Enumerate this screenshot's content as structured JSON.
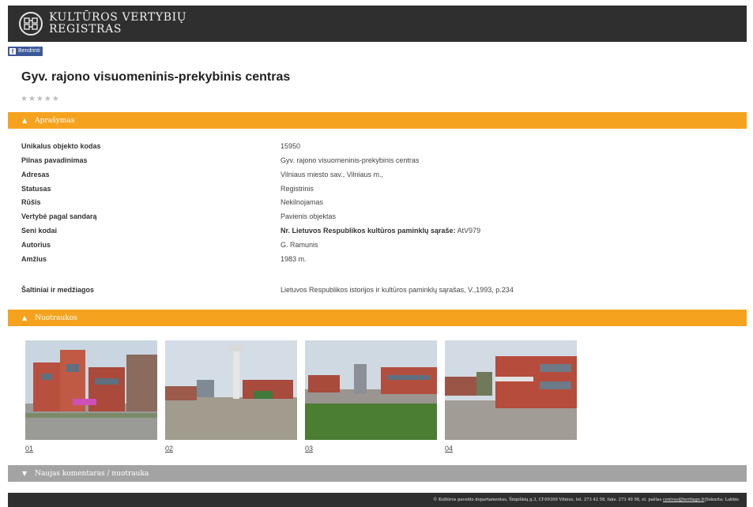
{
  "header": {
    "brand_line1": "KULTŪROS VERTYBIŲ",
    "brand_line2": "REGISTRAS"
  },
  "share": {
    "label": "Bendrinti"
  },
  "page": {
    "title": "Gyv. rajono visuomeninis-prekybinis centras",
    "rating_stars": "★★★★★",
    "rating_value": 0
  },
  "sections": {
    "description": "Aprašymas",
    "photos": "Nuotraukos",
    "new_comment": "Naujas komentaras / nuotrauka"
  },
  "details": [
    {
      "label": "Unikalus objekto kodas",
      "value": "15950"
    },
    {
      "label": "Pilnas pavadinimas",
      "value": "Gyv. rajono visuomeninis-prekybinis centras"
    },
    {
      "label": "Adresas",
      "value": "Vilniaus miesto sav., Vilniaus m.,"
    },
    {
      "label": "Statusas",
      "value": "Registrinis"
    },
    {
      "label": "Rūšis",
      "value": "Nekilnojamas"
    },
    {
      "label": "Vertybė pagal sandarą",
      "value": "Pavienis objektas"
    },
    {
      "label": "Seni kodai",
      "value_bold": "Nr. Lietuvos Respublikos kultūros paminklų sąraše:",
      "value": "AtV979"
    },
    {
      "label": "Autorius",
      "value": "G. Ramunis"
    },
    {
      "label": "Amžius",
      "value": "1983 m."
    }
  ],
  "sources": {
    "label": "Šaltiniai ir medžiagos",
    "value": "Lietuvos Respublikos istorijos ir kultūros paminklų sąrašas, V.,1993, p.234"
  },
  "photos": [
    {
      "label": "01"
    },
    {
      "label": "02"
    },
    {
      "label": "03"
    },
    {
      "label": "04"
    }
  ],
  "footer": {
    "text": "© Kultūros paveldo departamentas, Šnipiškių g.3, LT-09309 Vilnius, tel. 273 42 58, faks. 273 40 58, el. paštas",
    "email": "centras@heritage.lt",
    "sep": " | ",
    "made_by": "Sukurta: Labbis"
  },
  "colors": {
    "header_bg": "#2f2f2f",
    "accent_orange": "#f5a31e",
    "collapsed_gray": "#a3a3a3",
    "facebook_blue": "#3b5998"
  }
}
